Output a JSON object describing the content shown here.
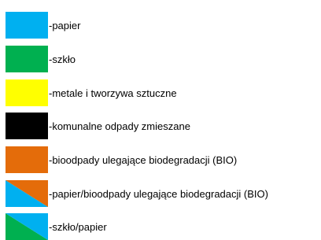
{
  "legend": {
    "items": [
      {
        "label": "-papier",
        "swatch": "solid",
        "colors": [
          "#00b0f0"
        ]
      },
      {
        "label": "-szkło",
        "swatch": "solid",
        "colors": [
          "#00b050"
        ]
      },
      {
        "label": "-metale i tworzywa sztuczne",
        "swatch": "solid",
        "colors": [
          "#ffff00"
        ]
      },
      {
        "label": "-komunalne odpady zmieszane",
        "swatch": "solid",
        "colors": [
          "#000000"
        ]
      },
      {
        "label": "-bioodpady ulegające biodegradacji (BIO)",
        "swatch": "solid",
        "colors": [
          "#e46c0a"
        ]
      },
      {
        "label": "-papier/bioodpady ulegające biodegradacji (BIO)",
        "swatch": "diagonal",
        "colors": [
          "#00b0f0",
          "#e46c0a"
        ]
      },
      {
        "label": "-szkło/papier",
        "swatch": "diagonal",
        "colors": [
          "#00b050",
          "#00b0f0"
        ]
      }
    ]
  }
}
